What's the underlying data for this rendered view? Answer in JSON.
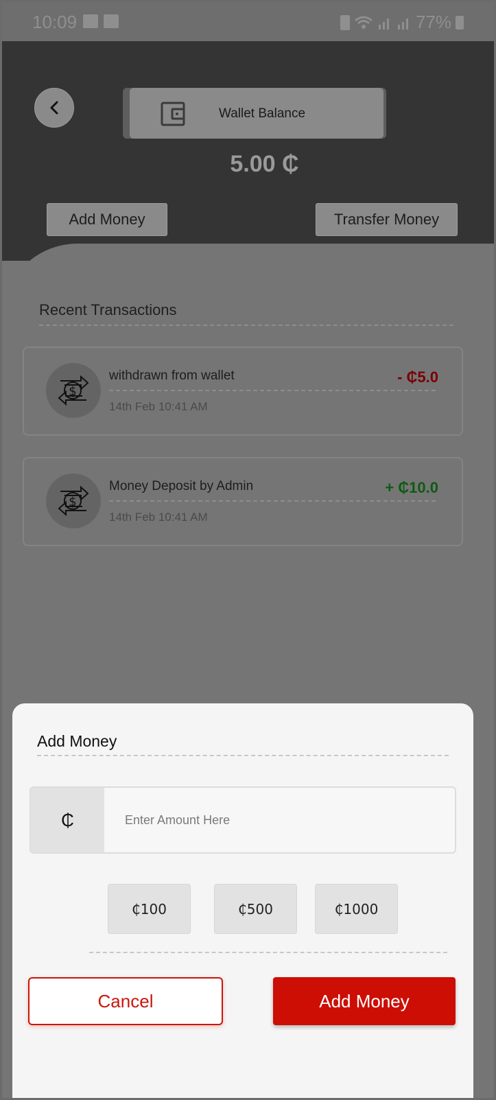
{
  "status_bar": {
    "time": "10:09",
    "battery": "77%"
  },
  "header": {
    "back_icon": "chevron-left-icon",
    "wallet_label": "Wallet Balance",
    "wallet_icon": "wallet-icon",
    "balance": "5.00 ₵",
    "add_money_label": "Add Money",
    "transfer_money_label": "Transfer Money"
  },
  "transactions": {
    "title": "Recent Transactions",
    "items": [
      {
        "title": "withdrawn from wallet",
        "date": "14th Feb 10:41 AM",
        "amount": "- ₵5.0",
        "type": "debit",
        "icon": "exchange-dollar-icon"
      },
      {
        "title": "Money Deposit by Admin",
        "date": "14th Feb 10:41 AM",
        "amount": "+ ₵10.0",
        "type": "credit",
        "icon": "exchange-dollar-icon"
      }
    ]
  },
  "sheet": {
    "title": "Add Money",
    "currency_symbol": "₵",
    "amount_placeholder": "Enter Amount Here",
    "amount_value": "",
    "quick_amounts": [
      "₵100",
      "₵500",
      "₵1000"
    ],
    "cancel_label": "Cancel",
    "submit_label": "Add Money"
  },
  "colors": {
    "accent": "#cc0e05",
    "debit": "#7a0000",
    "credit": "#0f5a14"
  }
}
